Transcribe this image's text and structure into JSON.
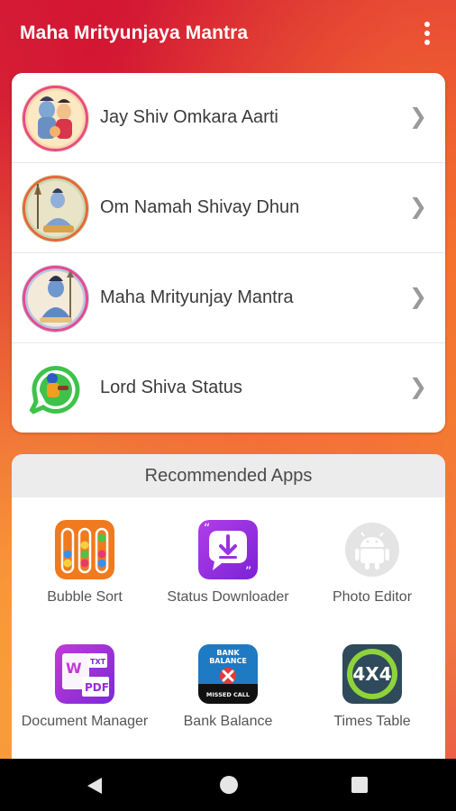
{
  "app_bar": {
    "title": "Maha Mrityunjaya Mantra",
    "overflow_icon": "more-vertical-icon"
  },
  "list": [
    {
      "label": "Jay Shiv Omkara Aarti",
      "icon": "shiva-family-image"
    },
    {
      "label": "Om Namah Shivay Dhun",
      "icon": "shiva-meditating-image"
    },
    {
      "label": "Maha Mrityunjay Mantra",
      "icon": "shiva-blue-image"
    },
    {
      "label": "Lord Shiva Status",
      "icon": "whatsapp-status-image"
    }
  ],
  "recommended": {
    "title": "Recommended Apps",
    "apps": [
      {
        "label": "Bubble Sort",
        "icon": "bubble-sort-icon"
      },
      {
        "label": "Status Downloader",
        "icon": "status-downloader-icon"
      },
      {
        "label": "Photo Editor",
        "icon": "android-placeholder-icon"
      },
      {
        "label": "Document Manager",
        "icon": "document-manager-icon"
      },
      {
        "label": "Bank Balance",
        "icon": "bank-balance-icon",
        "icon_text": [
          "BANK",
          "BALANCE",
          "MISSED CALL"
        ]
      },
      {
        "label": "Times Table",
        "icon": "times-table-icon",
        "icon_text": "4X4"
      }
    ]
  },
  "nav": {
    "back_icon": "back-triangle-icon",
    "home_icon": "home-circle-icon",
    "recents_icon": "recents-square-icon"
  },
  "colors": {
    "app_bar_text": "#ffffff",
    "card_bg": "#ffffff",
    "rec_header_bg": "#ececec",
    "nav_bg": "#000000"
  }
}
